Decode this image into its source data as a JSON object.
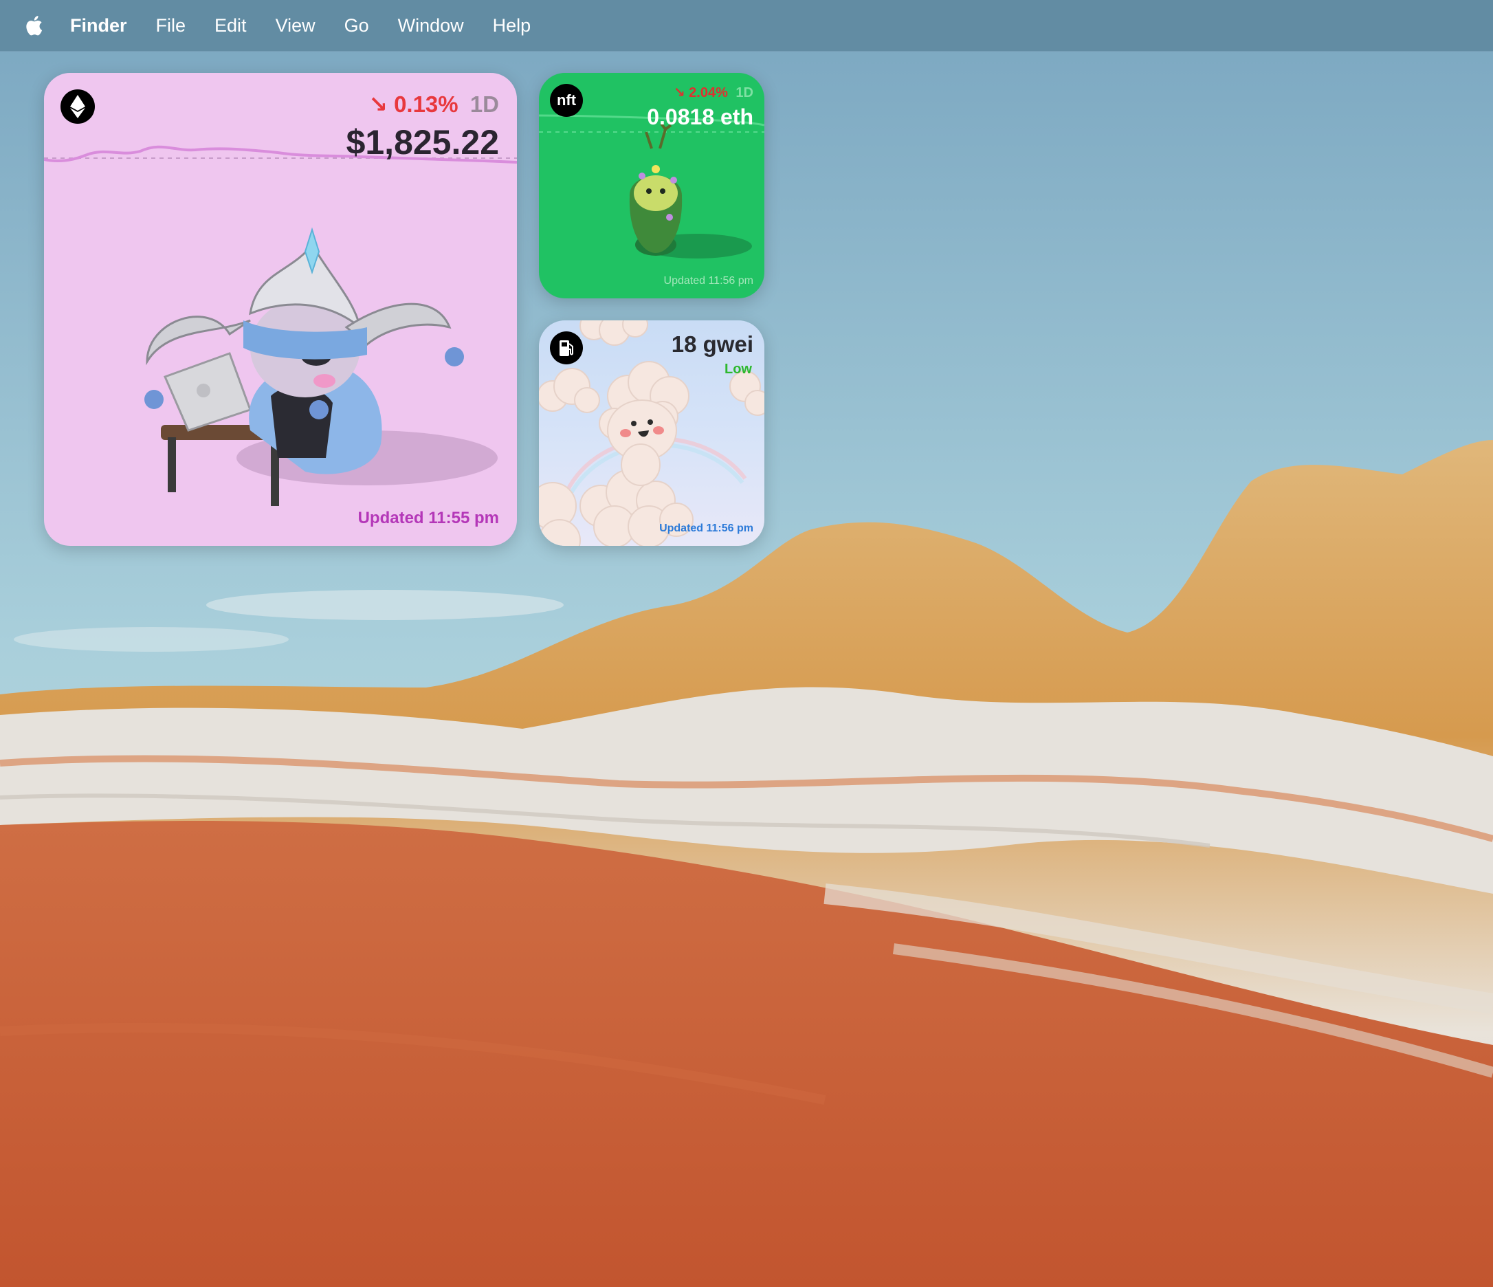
{
  "menubar": {
    "apple_icon": "apple-logo-icon",
    "items": [
      "Finder",
      "File",
      "Edit",
      "View",
      "Go",
      "Window",
      "Help"
    ]
  },
  "widgets": {
    "eth": {
      "icon": "ethereum-icon",
      "change_arrow": "↘",
      "change": "0.13%",
      "period": "1D",
      "price": "$1,825.22",
      "updated": "Updated 11:55 pm",
      "background": "#efc6ef",
      "change_color": "#e8383d",
      "updated_color": "#b437b8"
    },
    "nft": {
      "badge": "nft",
      "change_arrow": "↘",
      "change": "2.04%",
      "period": "1D",
      "price": "0.0818 eth",
      "updated": "Updated 11:56 pm",
      "background": "#20c263"
    },
    "gas": {
      "icon": "fuel-pump-icon",
      "price": "18 gwei",
      "level": "Low",
      "updated": "Updated 11:56 pm",
      "level_color": "#2eb82e",
      "updated_color": "#2b7ad8"
    }
  }
}
